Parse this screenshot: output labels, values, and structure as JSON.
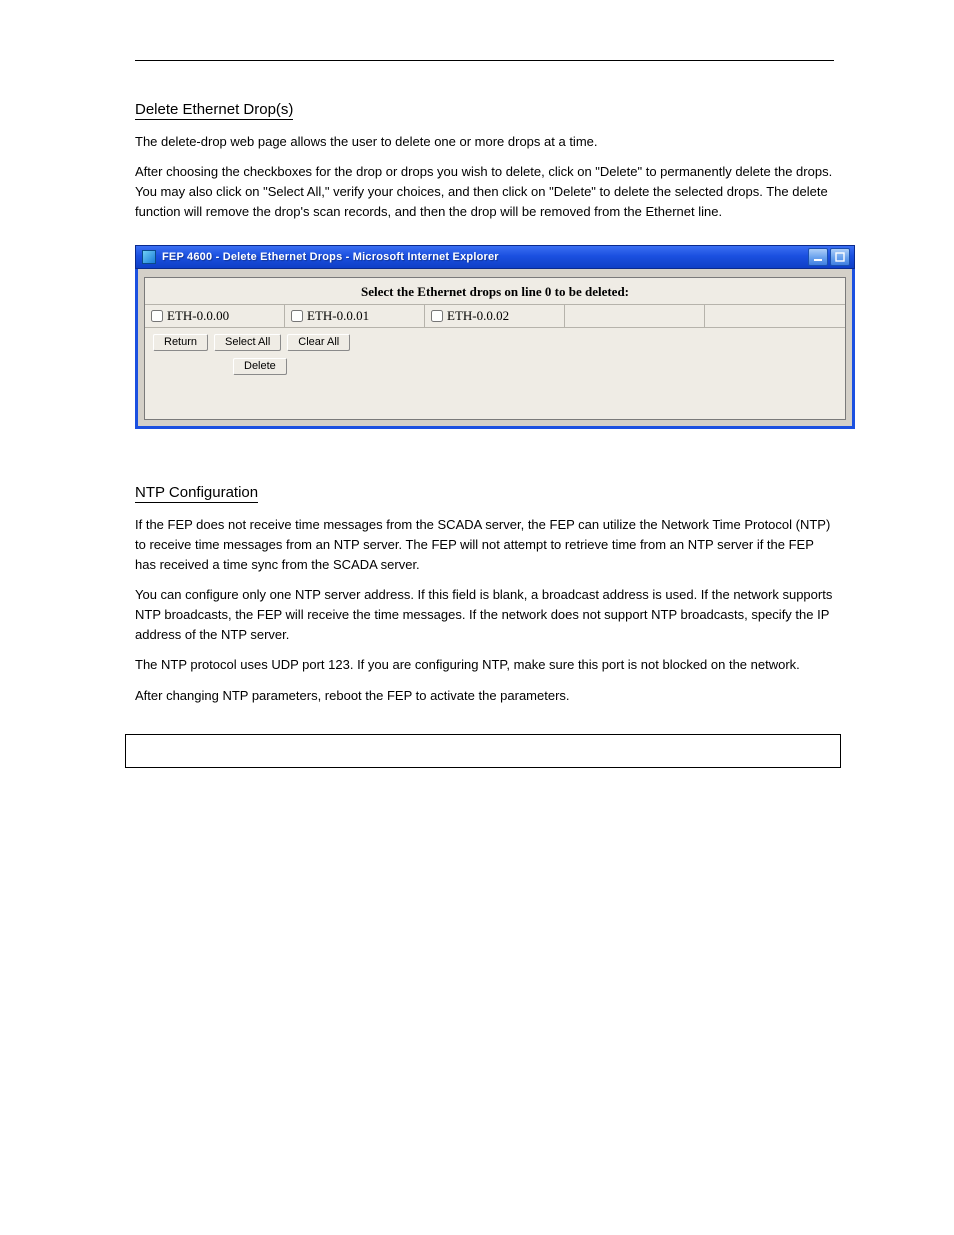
{
  "section_delete": {
    "heading": "Delete Ethernet Drop(s)",
    "paragraphs": [
      "The delete-drop web page allows the user to delete one or more drops at a time.",
      "After choosing the checkboxes for the drop or drops you wish to delete, click on \"Delete\" to permanently delete the drops. You may also click on \"Select All,\" verify your choices, and then click on \"Delete\" to delete the selected drops. The delete function will remove the drop's scan records, and then the drop will be removed from the Ethernet line."
    ]
  },
  "section_ntp": {
    "heading": "NTP Configuration",
    "paragraphs": [
      "If the FEP does not receive time messages from the SCADA server, the FEP can utilize the Network Time Protocol (NTP) to receive time messages from an NTP server. The FEP will not attempt to retrieve time from an NTP server if the FEP has received a time sync from the SCADA server.",
      "You can configure only one NTP server address. If this field is blank, a broadcast address is used. If the network supports NTP broadcasts, the FEP will receive the time messages. If the network does not support NTP broadcasts, specify the IP address of the NTP server.",
      "The NTP protocol uses UDP port 123. If you are configuring NTP, make sure this port is not blocked on the network.",
      "After changing NTP parameters, reboot the FEP to activate the parameters."
    ]
  },
  "window": {
    "title": "FEP 4600 - Delete Ethernet Drops - Microsoft Internet Explorer",
    "header": "Select the Ethernet drops on line 0 to be deleted:",
    "drops": [
      "ETH-0.0.00",
      "ETH-0.0.01",
      "ETH-0.0.02"
    ],
    "buttons": {
      "return": "Return",
      "select_all": "Select All",
      "clear_all": "Clear All",
      "delete": "Delete"
    }
  }
}
